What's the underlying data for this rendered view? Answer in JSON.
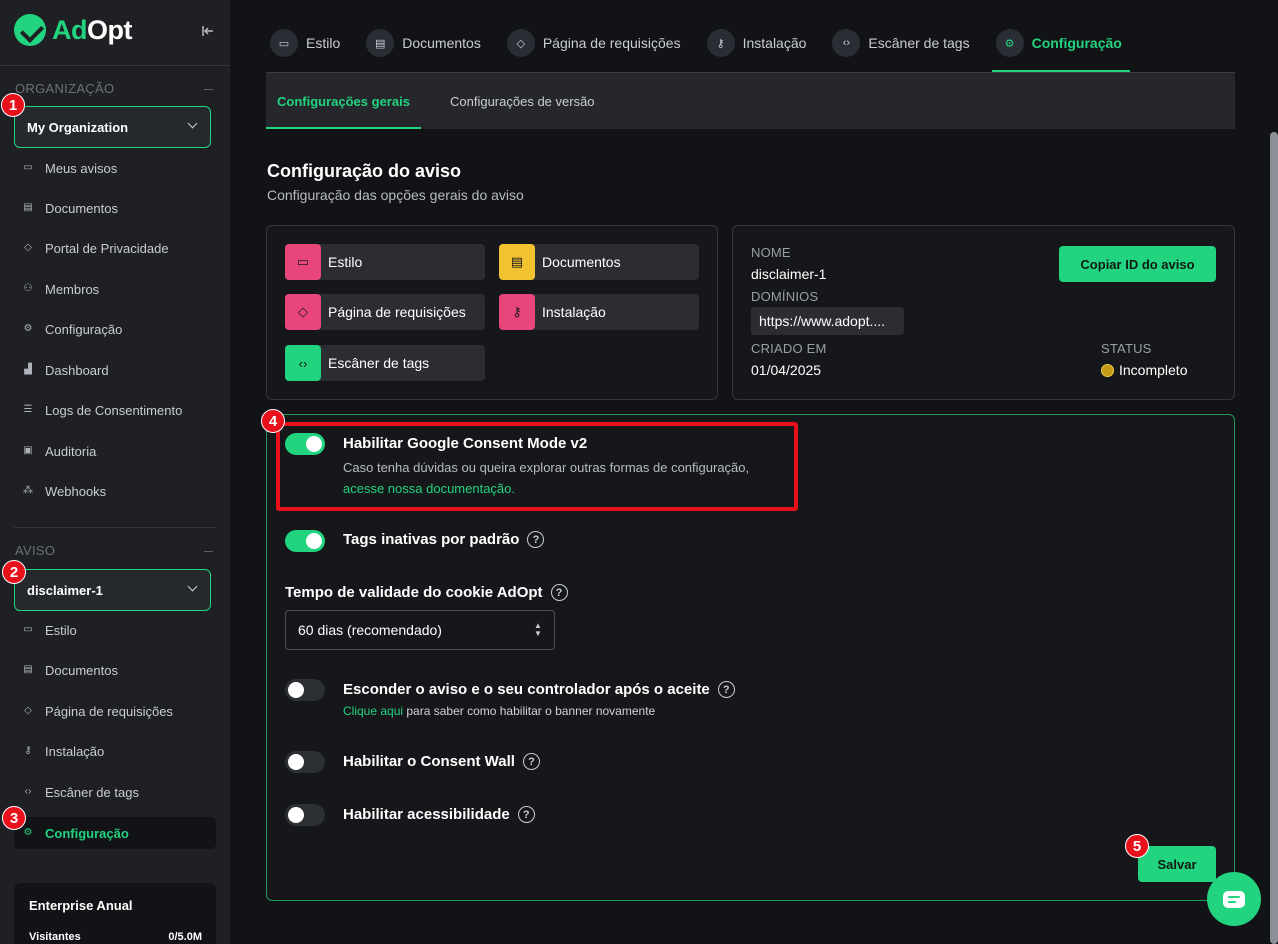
{
  "brand": {
    "ad": "Ad",
    "opt": "Opt",
    "accent": "#22d37f"
  },
  "sidebar": {
    "org_section_label": "ORGANIZAÇÃO",
    "org_select": "My Organization",
    "org_items": [
      {
        "label": "Meus avisos",
        "icon": "chat-icon"
      },
      {
        "label": "Documentos",
        "icon": "document-icon"
      },
      {
        "label": "Portal de Privacidade",
        "icon": "shield-icon"
      },
      {
        "label": "Membros",
        "icon": "users-icon"
      },
      {
        "label": "Configuração",
        "icon": "gear-icon"
      },
      {
        "label": "Dashboard",
        "icon": "bar-chart-icon"
      },
      {
        "label": "Logs de Consentimento",
        "icon": "list-icon"
      },
      {
        "label": "Auditoria",
        "icon": "clipboard-icon"
      },
      {
        "label": "Webhooks",
        "icon": "webhook-icon"
      }
    ],
    "aviso_section_label": "AVISO",
    "aviso_select": "disclaimer-1",
    "aviso_items": [
      {
        "label": "Estilo",
        "icon": "chat-icon"
      },
      {
        "label": "Documentos",
        "icon": "document-icon"
      },
      {
        "label": "Página de requisições",
        "icon": "shield-icon"
      },
      {
        "label": "Instalação",
        "icon": "key-icon"
      },
      {
        "label": "Escâner de tags",
        "icon": "code-icon"
      },
      {
        "label": "Configuração",
        "icon": "gear-icon",
        "active": true
      }
    ],
    "plan": {
      "title": "Enterprise Anual",
      "visitors_label": "Visitantes",
      "visitors_value": "0/5.0M"
    }
  },
  "badges": [
    "1",
    "2",
    "3",
    "4",
    "5"
  ],
  "top_tabs": [
    {
      "label": "Estilo",
      "icon": "chat-icon"
    },
    {
      "label": "Documentos",
      "icon": "document-icon"
    },
    {
      "label": "Página de requisições",
      "icon": "shield-icon"
    },
    {
      "label": "Instalação",
      "icon": "key-icon"
    },
    {
      "label": "Escâner de tags",
      "icon": "code-icon"
    },
    {
      "label": "Configuração",
      "icon": "gear-icon",
      "active": true
    }
  ],
  "sub_tabs": [
    {
      "label": "Configurações gerais",
      "active": true
    },
    {
      "label": "Configurações de versão"
    }
  ],
  "page": {
    "title": "Configuração do aviso",
    "subtitle": "Configuração das opções gerais do aviso"
  },
  "shortcuts": [
    {
      "label": "Estilo",
      "color": "#e8457a"
    },
    {
      "label": "Documentos",
      "color": "#f2c230"
    },
    {
      "label": "Página de requisições",
      "color": "#e8457a"
    },
    {
      "label": "Instalação",
      "color": "#e8457a"
    },
    {
      "label": "Escâner de tags",
      "color": "#22d37f"
    }
  ],
  "info": {
    "name_label": "NOME",
    "name_value": "disclaimer-1",
    "domains_label": "DOMÍNIOS",
    "domain_value": "https://www.adopt....",
    "created_label": "CRIADO EM",
    "created_value": "01/04/2025",
    "status_label": "STATUS",
    "status_value": "Incompleto",
    "copy_button": "Copiar ID do aviso"
  },
  "settings": {
    "gcm": {
      "title": "Habilitar Google Consent Mode v2",
      "desc": "Caso tenha dúvidas ou queira explorar outras formas de configuração,",
      "link": "acesse nossa documentação.",
      "enabled": true
    },
    "tags_inactive": {
      "title": "Tags inativas por padrão",
      "enabled": true
    },
    "cookie_validity": {
      "title": "Tempo de validade do cookie AdOpt",
      "value": "60 dias (recomendado)"
    },
    "hide_notice": {
      "title": "Esconder o aviso e o seu controlador após o aceite",
      "link": "Clique aqui",
      "desc": " para saber como habilitar o banner novamente",
      "enabled": false
    },
    "consent_wall": {
      "title": "Habilitar o Consent Wall",
      "enabled": false
    },
    "accessibility": {
      "title": "Habilitar acessibilidade",
      "enabled": false
    },
    "save_button": "Salvar"
  }
}
